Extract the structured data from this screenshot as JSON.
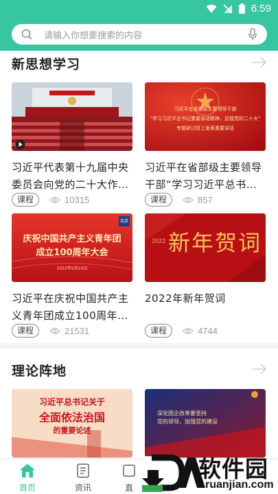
{
  "status_bar": {
    "time": "6:59"
  },
  "search": {
    "placeholder": "请输入你想要搜索的内容"
  },
  "sections": [
    {
      "title": "新思想学习",
      "cards": [
        {
          "title_line1": "习近平代表第十九届中央",
          "title_line2": "委员会向党的二十大作…",
          "tag": "课程",
          "views": "10315"
        },
        {
          "title_line1": "习近平在省部级主要领导",
          "title_line2": "干部“学习习近平总书记…",
          "tag": "课程",
          "views": "857",
          "thumb_text_1": "习近平在省部级主要领导干部",
          "thumb_text_2": "“学习习近平总书记重要讲话精神，迎接党的二十大”",
          "thumb_text_3": "专题研讨班上发表重要讲话"
        },
        {
          "title_line1": "习近平在庆祝中国共产主",
          "title_line2": "义青年团成立100周年大…",
          "tag": "课程",
          "views": "21531",
          "thumb_text_1": "庆祝中国共产主义青年团",
          "thumb_text_2": "成立100周年大会",
          "thumb_date": "2022年5月10日",
          "thumb_badge": "北京"
        },
        {
          "title_line1": "2022年新年贺词",
          "title_line2": "",
          "tag": "课程",
          "views": "4744",
          "thumb_text_1": "新年贺词",
          "thumb_year": "2022"
        }
      ]
    },
    {
      "title": "理论阵地",
      "cards": [
        {
          "thumb_text_1": "习近平总书记关于",
          "thumb_text_2": "全面依法治国",
          "thumb_text_3": "的重要论述"
        },
        {
          "thumb_text_1": "深化国企改革要坚持",
          "thumb_text_2": "党的领导、加强党的建设"
        }
      ]
    }
  ],
  "bottom_nav": [
    {
      "label": "首页",
      "icon": "home-icon",
      "active": true
    },
    {
      "label": "资讯",
      "icon": "news-icon",
      "active": false
    },
    {
      "label": "直",
      "icon": "live-icon",
      "active": false
    }
  ],
  "watermark": {
    "brand": "软件园",
    "url": "ruanjian.com"
  },
  "colors": {
    "accent": "#36c6a2",
    "red": "#c8141a",
    "gold": "#ffd76a"
  }
}
